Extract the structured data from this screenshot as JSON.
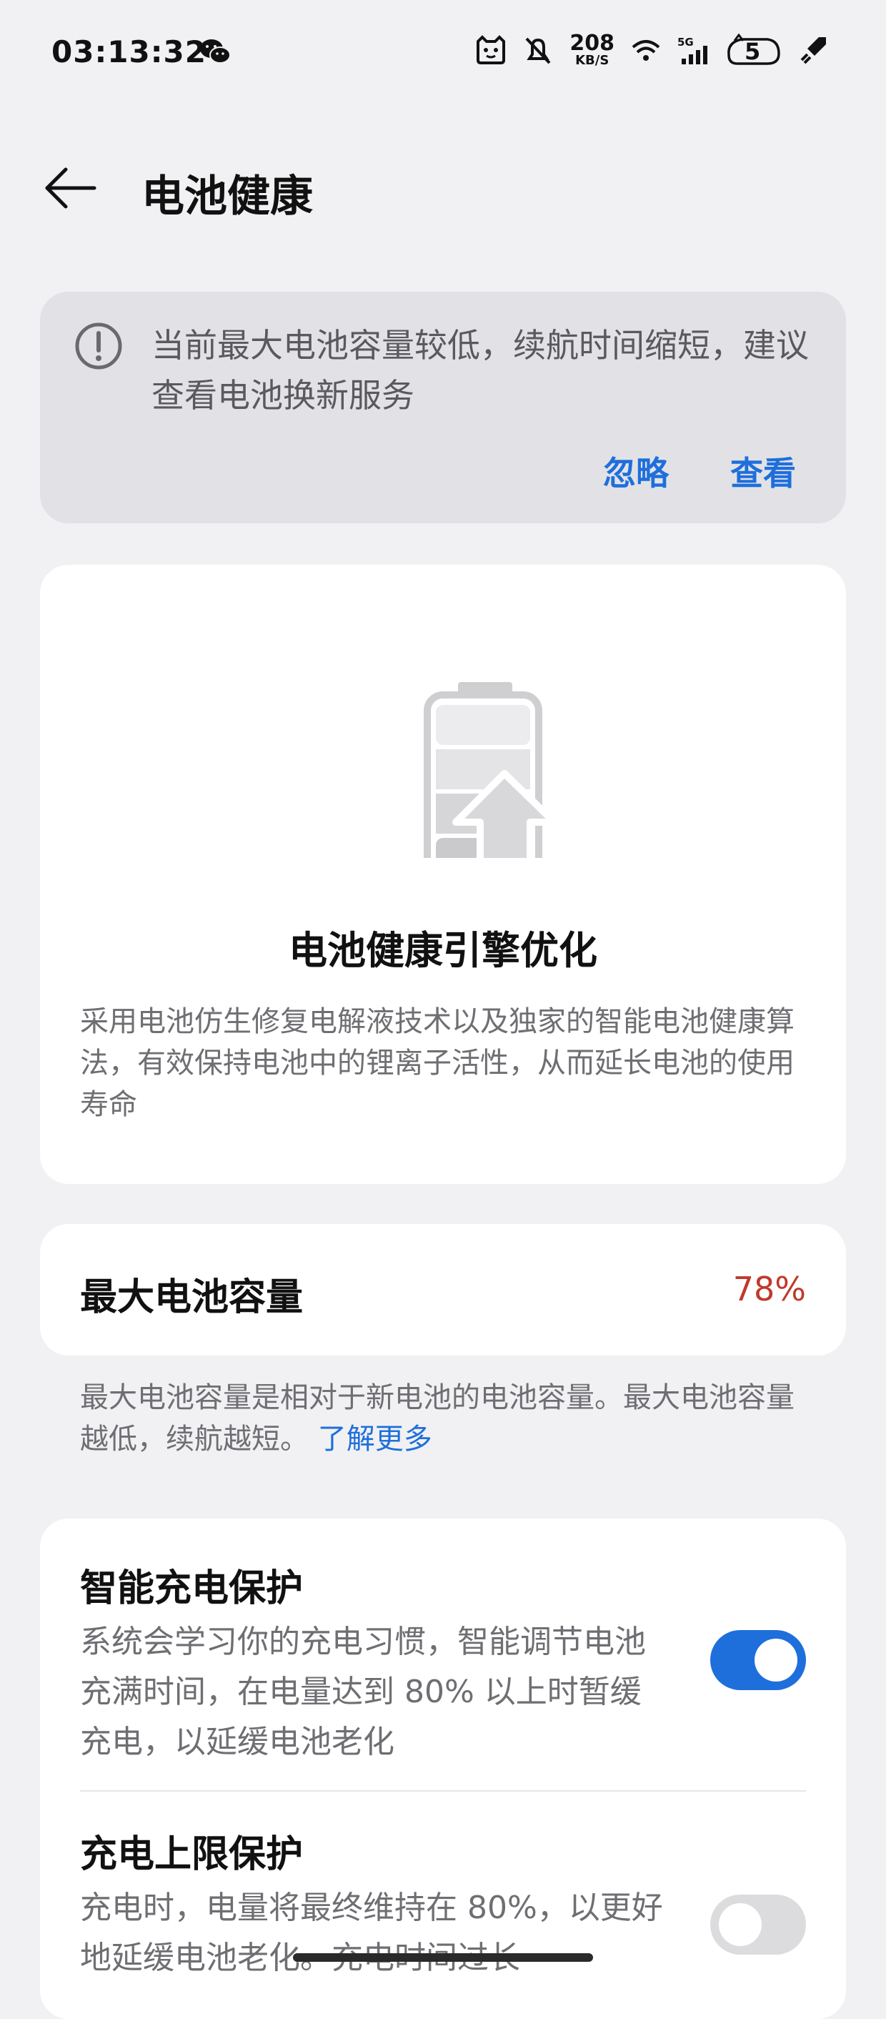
{
  "status_bar": {
    "time": "03:13:32",
    "net_speed_value": "208",
    "net_speed_unit": "KB/S",
    "network_label": "5G",
    "badge_number": "5",
    "icons": [
      "wechat-icon",
      "cat-face-icon",
      "bell-off-icon",
      "network-speed",
      "wifi-icon",
      "signal-5g-icon",
      "pet-badge-icon",
      "rocket-icon"
    ]
  },
  "header": {
    "title": "电池健康"
  },
  "alert": {
    "message": "当前最大电池容量较低，续航时间缩短，建议查看电池换新服务",
    "ignore_label": "忽略",
    "view_label": "查看"
  },
  "engine": {
    "title": "电池健康引擎优化",
    "description": "采用电池仿生修复电解液技术以及独家的智能电池健康算法，有效保持电池中的锂离子活性，从而延长电池的使用寿命"
  },
  "capacity": {
    "label": "最大电池容量",
    "value": "78%",
    "note": "最大电池容量是相对于新电池的电池容量。最大电池容量越低，续航越短。",
    "learn_more": "了解更多"
  },
  "settings": [
    {
      "title": "智能充电保护",
      "description": "系统会学习你的充电习惯，智能调节电池充满时间，在电量达到 80% 以上时暂缓充电，以延缓电池老化",
      "enabled": true
    },
    {
      "title": "充电上限保护",
      "description": "充电时，电量将最终维持在 80%，以更好地延缓电池老化。充电时间过长",
      "enabled": false
    }
  ],
  "colors": {
    "accent": "#1e6fdc",
    "warning_value": "#c0392b",
    "background": "#f1f1f3"
  }
}
